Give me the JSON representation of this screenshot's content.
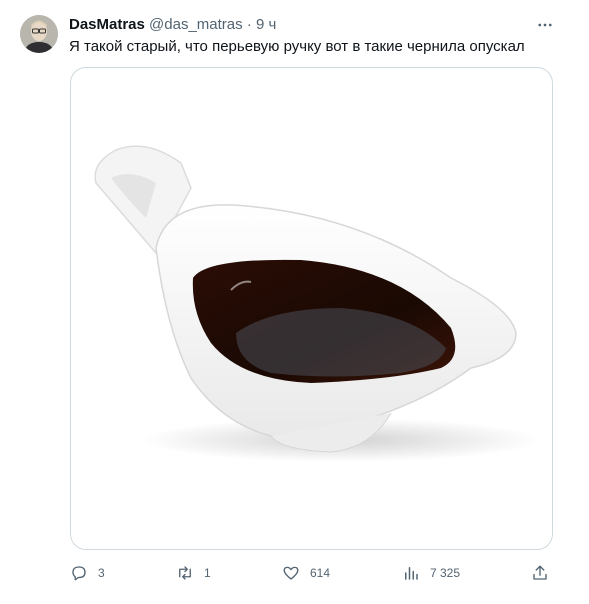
{
  "tweet": {
    "author_name": "DasMatras",
    "author_handle": "@das_matras",
    "separator": "·",
    "time": "9 ч",
    "text": "Я такой старый, что перьевую ручку вот в такие чернила опускал"
  },
  "actions": {
    "replies": "3",
    "retweets": "1",
    "likes": "614",
    "views": "7 325"
  },
  "icons": {
    "more": "more-horizontal-icon",
    "reply": "reply-icon",
    "retweet": "retweet-icon",
    "like": "heart-icon",
    "views": "views-bar-chart-icon",
    "share": "share-icon"
  },
  "colors": {
    "text": "#0f1419",
    "secondary": "#536471",
    "border": "#cfd9de"
  }
}
